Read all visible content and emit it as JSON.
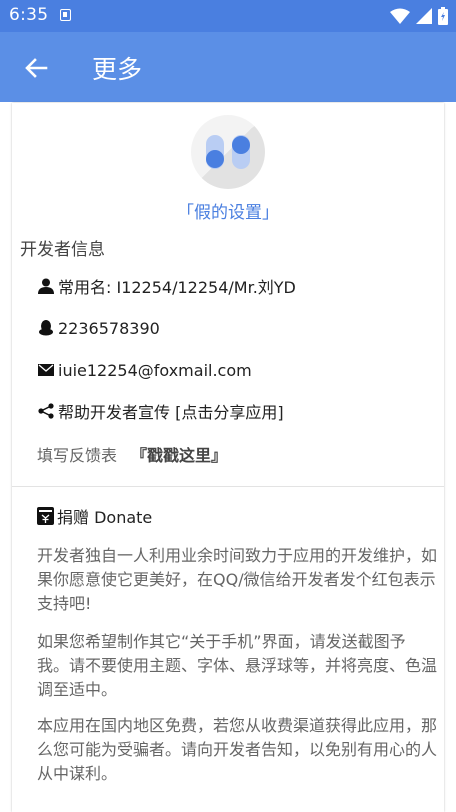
{
  "status_bar": {
    "time": "6:35",
    "notif_icon": "app-notification-icon"
  },
  "app_bar": {
    "title": "更多",
    "back_icon": "arrow-back-icon",
    "color": "#5b8fe6"
  },
  "app": {
    "name": "「假的设置」"
  },
  "developer": {
    "section_title": "开发者信息",
    "username": "常用名: I12254/12254/Mr.刘YD",
    "qq": "2236578390",
    "email": "iuie12254@foxmail.com",
    "share": "帮助开发者宣传 [点击分享应用]",
    "feedback_label": "填写反馈表",
    "feedback_link": "『戳戳这里』"
  },
  "donate": {
    "title": "捐赠 Donate",
    "paragraphs": [
      "开发者独自一人利用业余时间致力于应用的开发维护，如果你愿意使它更美好，在QQ/微信给开发者发个红包表示支持吧!",
      "如果您希望制作其它“关于手机”界面，请发送截图予我。请不要使用主题、字体、悬浮球等，并将亮度、色温调至适中。",
      "本应用在国内地区免费，若您从收费渠道获得此应用，那么您可能为受骗者。请向开发者告知，以免别有用心的人从中谋利。"
    ]
  }
}
